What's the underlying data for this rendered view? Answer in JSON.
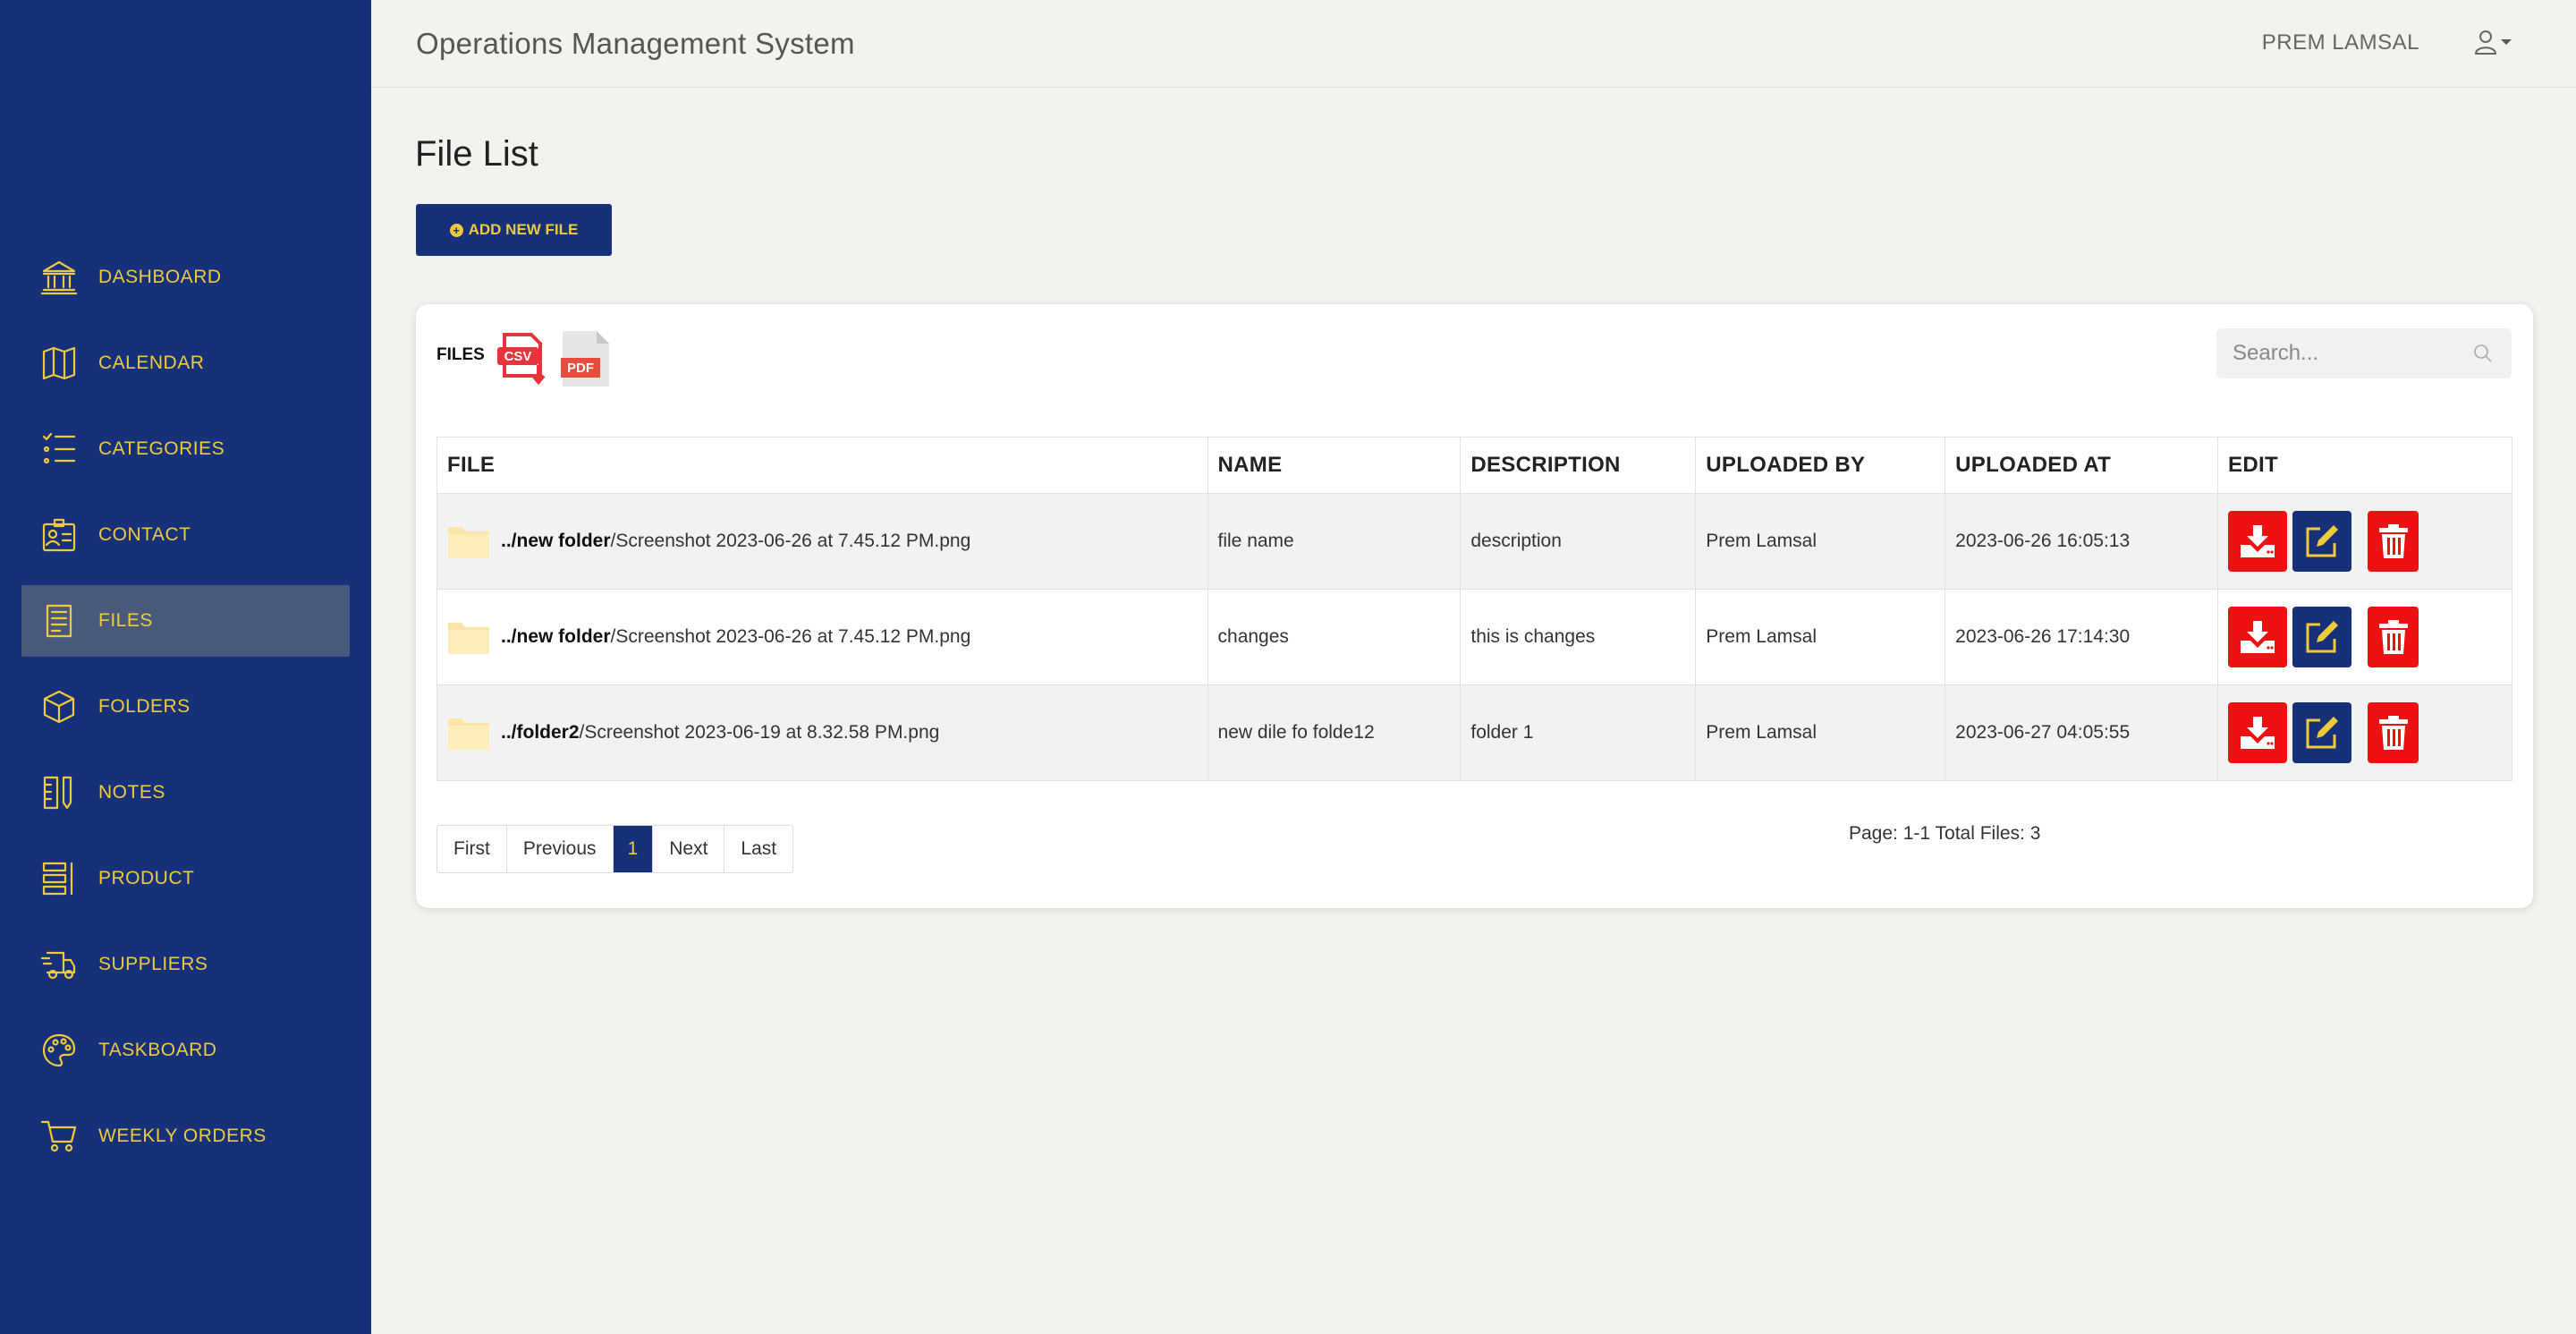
{
  "header": {
    "app_title": "Operations Management System",
    "user_name": "PREM LAMSAL",
    "user_icon": "user-icon"
  },
  "sidebar": {
    "items": [
      {
        "label": "DASHBOARD",
        "icon": "bank-icon"
      },
      {
        "label": "CALENDAR",
        "icon": "map-icon"
      },
      {
        "label": "CATEGORIES",
        "icon": "list-icon"
      },
      {
        "label": "CONTACT",
        "icon": "id-card-icon"
      },
      {
        "label": "FILES",
        "icon": "file-text-icon",
        "active": true
      },
      {
        "label": "FOLDERS",
        "icon": "box-icon"
      },
      {
        "label": "NOTES",
        "icon": "notes-icon"
      },
      {
        "label": "PRODUCT",
        "icon": "product-icon"
      },
      {
        "label": "SUPPLIERS",
        "icon": "truck-icon"
      },
      {
        "label": "TASKBOARD",
        "icon": "palette-icon"
      },
      {
        "label": "WEEKLY ORDERS",
        "icon": "cart-icon"
      }
    ]
  },
  "main": {
    "page_title": "File List",
    "add_button": "ADD NEW FILE",
    "files_label": "FILES",
    "csv_label": "CSV",
    "pdf_label": "PDF",
    "search_placeholder": "Search...",
    "columns": [
      "FILE",
      "NAME",
      "DESCRIPTION",
      "UPLOADED BY",
      "UPLOADED AT",
      "EDIT"
    ],
    "rows": [
      {
        "folder": "../new folder",
        "file": "/Screenshot 2023-06-26 at 7.45.12 PM.png",
        "name": "file name",
        "description": "description",
        "uploaded_by": "Prem Lamsal",
        "uploaded_at": "2023-06-26 16:05:13"
      },
      {
        "folder": "../new folder",
        "file": "/Screenshot 2023-06-26 at 7.45.12 PM.png",
        "name": "changes",
        "description": "this is changes",
        "uploaded_by": "Prem Lamsal",
        "uploaded_at": "2023-06-26 17:14:30"
      },
      {
        "folder": "../folder2",
        "file": "/Screenshot 2023-06-19 at 8.32.58 PM.png",
        "name": "new dile fo folde12",
        "description": "folder 1",
        "uploaded_by": "Prem Lamsal",
        "uploaded_at": "2023-06-27 04:05:55"
      }
    ],
    "pagination": {
      "first": "First",
      "previous": "Previous",
      "current": "1",
      "next": "Next",
      "last": "Last"
    },
    "page_info": "Page: 1-1 Total Files: 3"
  },
  "colors": {
    "sidebar_bg": "#17307a",
    "accent": "#efcb3a",
    "action_red": "#ee1111",
    "active_item": "#49597c"
  }
}
